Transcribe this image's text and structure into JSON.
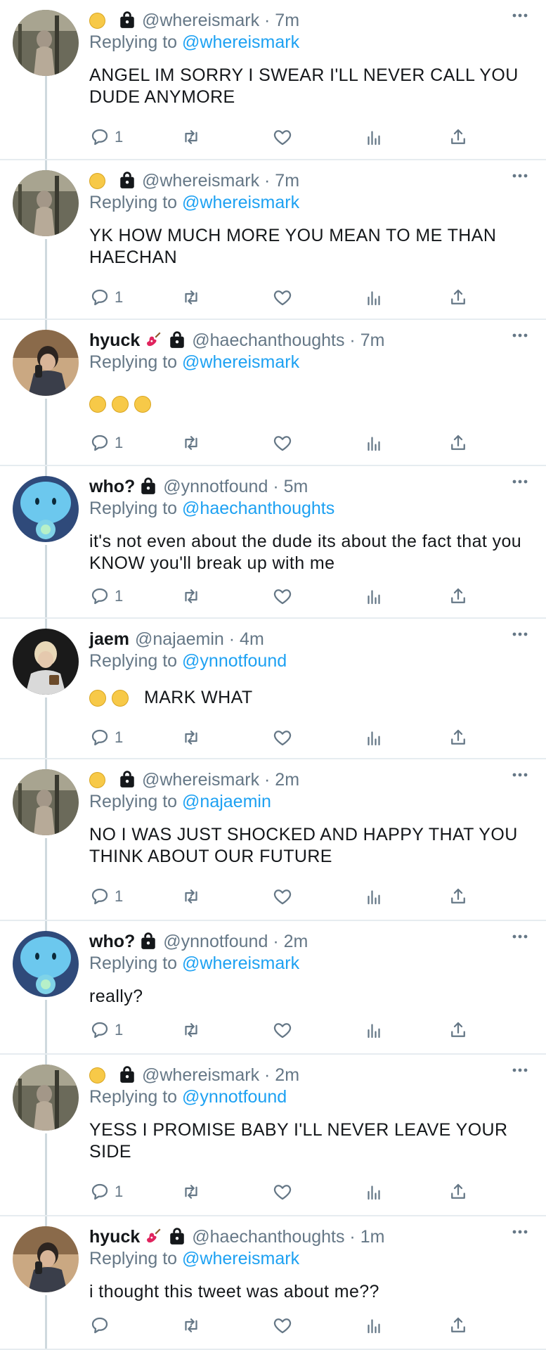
{
  "tweets": [
    {
      "name": "",
      "has_face_emoji": true,
      "has_guitar": false,
      "has_lock": true,
      "handle": "@whereismark",
      "time": "7m",
      "replying_prefix": "Replying to",
      "replying_to": "@whereismark",
      "text": "ANGEL IM SORRY I SWEAR I'LL NEVER CALL YOU DUDE ANYMORE",
      "emojis": [],
      "reply_count": "1",
      "avatar": "mark-avatar"
    },
    {
      "name": "",
      "has_face_emoji": true,
      "has_guitar": false,
      "has_lock": true,
      "handle": "@whereismark",
      "time": "7m",
      "replying_prefix": "Replying to",
      "replying_to": "@whereismark",
      "text": "YK HOW MUCH MORE YOU MEAN TO ME THAN HAECHAN",
      "emojis": [],
      "reply_count": "1",
      "avatar": "mark-avatar"
    },
    {
      "name": "hyuck",
      "has_face_emoji": false,
      "has_guitar": true,
      "has_lock": true,
      "handle": "@haechanthoughts",
      "time": "7m",
      "replying_prefix": "Replying to",
      "replying_to": "@whereismark",
      "text": "",
      "emojis": [
        "raised-eyebrow-emoji",
        "raised-eyebrow-emoji",
        "raised-eyebrow-emoji"
      ],
      "reply_count": "1",
      "avatar": "hyuck-avatar"
    },
    {
      "name": "who?",
      "has_face_emoji": false,
      "has_guitar": false,
      "has_lock": true,
      "handle": "@ynnotfound",
      "time": "5m",
      "replying_prefix": "Replying to",
      "replying_to": "@haechanthoughts",
      "text": "it's not even about the dude its about the fact that you KNOW you'll break up with me",
      "emojis": [],
      "reply_count": "1",
      "avatar": "who-avatar"
    },
    {
      "name": "jaem",
      "has_face_emoji": false,
      "has_guitar": false,
      "has_lock": false,
      "handle": "@najaemin",
      "time": "4m",
      "replying_prefix": "Replying to",
      "replying_to": "@ynnotfound",
      "text": "MARK WHAT",
      "emojis": [
        "worried-emoji",
        "worried-emoji"
      ],
      "reply_count": "1",
      "avatar": "jaem-avatar"
    },
    {
      "name": "",
      "has_face_emoji": true,
      "has_guitar": false,
      "has_lock": true,
      "handle": "@whereismark",
      "time": "2m",
      "replying_prefix": "Replying to",
      "replying_to": "@najaemin",
      "text": "NO I WAS JUST SHOCKED AND HAPPY  THAT YOU THINK ABOUT OUR FUTURE",
      "emojis": [],
      "reply_count": "1",
      "avatar": "mark-avatar"
    },
    {
      "name": "who?",
      "has_face_emoji": false,
      "has_guitar": false,
      "has_lock": true,
      "handle": "@ynnotfound",
      "time": "2m",
      "replying_prefix": "Replying to",
      "replying_to": "@whereismark",
      "text": "really?",
      "emojis": [],
      "reply_count": "1",
      "avatar": "who-avatar"
    },
    {
      "name": "",
      "has_face_emoji": true,
      "has_guitar": false,
      "has_lock": true,
      "handle": "@whereismark",
      "time": "2m",
      "replying_prefix": "Replying to",
      "replying_to": "@ynnotfound",
      "text": "YESS I PROMISE BABY I'LL NEVER LEAVE YOUR SIDE",
      "emojis": [],
      "reply_count": "1",
      "avatar": "mark-avatar"
    },
    {
      "name": "hyuck",
      "has_face_emoji": false,
      "has_guitar": true,
      "has_lock": true,
      "handle": "@haechanthoughts",
      "time": "1m",
      "replying_prefix": "Replying to",
      "replying_to": "@whereismark",
      "text": "i thought this tweet was about me??",
      "emojis": [],
      "reply_count": "",
      "avatar": "hyuck-avatar"
    }
  ],
  "colors": {
    "link": "#1da1f2",
    "muted": "#657786",
    "text": "#14171a",
    "thread_line": "#cfd9de"
  },
  "icons": {
    "reply": "reply-icon",
    "retweet": "retweet-icon",
    "like": "heart-icon",
    "analytics": "analytics-icon",
    "share": "share-icon",
    "more": "more-icon",
    "lock": "lock-icon"
  }
}
